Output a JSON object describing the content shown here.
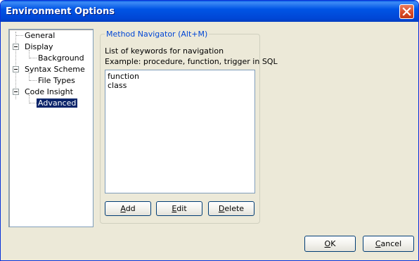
{
  "window": {
    "title": "Environment Options"
  },
  "tree": {
    "items": [
      {
        "label": "General"
      },
      {
        "label": "Display"
      },
      {
        "label": "Background"
      },
      {
        "label": "Syntax Scheme"
      },
      {
        "label": "File Types"
      },
      {
        "label": "Code Insight"
      },
      {
        "label": "Advanced",
        "selected": true
      }
    ]
  },
  "method_navigator": {
    "legend": "Method Navigator (Alt+M)",
    "description_line1": "List of keywords for navigation",
    "description_line2": "Example: procedure, function, trigger in SQL",
    "keywords": [
      "function",
      "class"
    ],
    "buttons": {
      "add": {
        "mnemonic": "A",
        "rest": "dd"
      },
      "edit": {
        "mnemonic": "E",
        "rest": "dit"
      },
      "delete": {
        "mnemonic": "D",
        "rest": "elete"
      }
    }
  },
  "footer": {
    "ok": {
      "mnemonic": "O",
      "rest": "K"
    },
    "cancel": {
      "mnemonic": "C",
      "rest": "ancel"
    }
  },
  "colors": {
    "titlebar": "#0055e5",
    "dialog_bg": "#ece9d8",
    "selection": "#0a246a",
    "legend_text": "#0046d5"
  }
}
